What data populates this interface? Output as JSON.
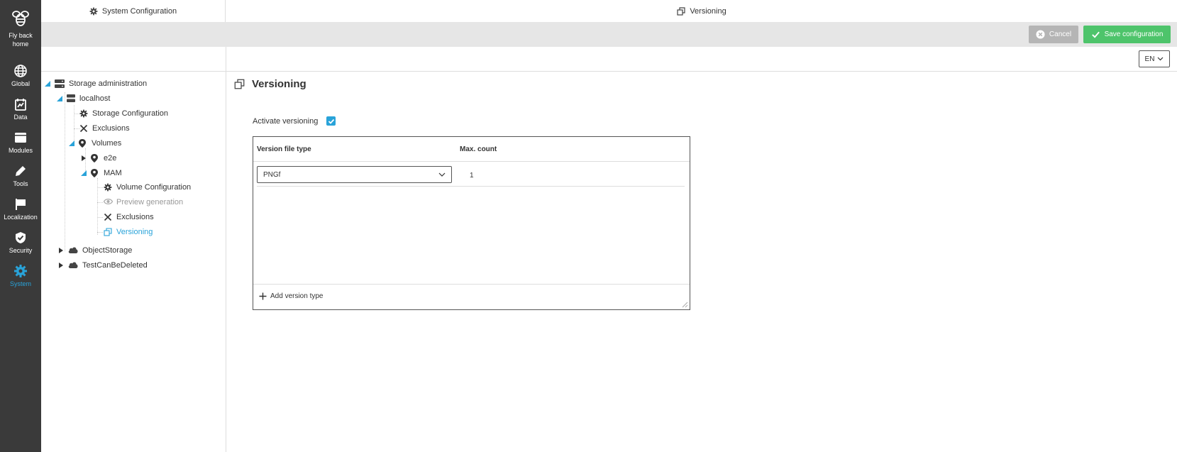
{
  "rail": {
    "items": [
      {
        "label_lines": [
          "Fly back",
          "home"
        ],
        "icon": "bee-icon"
      },
      {
        "label": "Global",
        "icon": "globe-icon"
      },
      {
        "label": "Data",
        "icon": "data-icon"
      },
      {
        "label": "Modules",
        "icon": "modules-icon"
      },
      {
        "label": "Tools",
        "icon": "pencil-icon"
      },
      {
        "label": "Localization",
        "icon": "flag-icon"
      },
      {
        "label": "Security",
        "icon": "shield-icon"
      },
      {
        "label": "System",
        "icon": "gear-icon",
        "active": true
      }
    ],
    "home_line1": "Fly back",
    "home_line2": "home",
    "global": "Global",
    "data": "Data",
    "modules": "Modules",
    "tools": "Tools",
    "localization": "Localization",
    "security": "Security",
    "system": "System"
  },
  "header": {
    "left_title": "System Configuration",
    "right_title": "Versioning"
  },
  "actions": {
    "cancel": "Cancel",
    "save": "Save configuration"
  },
  "language": {
    "selected": "EN"
  },
  "tree": {
    "storage_admin": "Storage administration",
    "localhost": "localhost",
    "storage_config": "Storage Configuration",
    "exclusions": "Exclusions",
    "volumes": "Volumes",
    "e2e": "e2e",
    "mam": "MAM",
    "volume_config": "Volume Configuration",
    "preview_generation": "Preview generation",
    "mam_exclusions": "Exclusions",
    "versioning": "Versioning",
    "object_storage": "ObjectStorage",
    "test_can_be_deleted": "TestCanBeDeleted"
  },
  "main": {
    "title": "Versioning",
    "activate_label": "Activate versioning",
    "activate_checked": true,
    "table": {
      "col_type": "Version file type",
      "col_count": "Max. count",
      "rows": [
        {
          "type": "PNGf",
          "count": "1"
        }
      ],
      "add_label": "Add version type"
    }
  },
  "colors": {
    "accent": "#29a3d9",
    "save": "#4ec46b",
    "cancel": "#b5b5b5",
    "rail_bg": "#3a3a3a"
  }
}
